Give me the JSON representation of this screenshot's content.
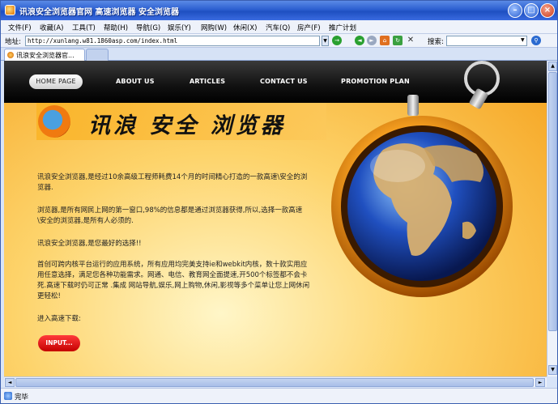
{
  "window": {
    "title": "讯浪安全浏览器官网 高速浏览器 安全浏览器"
  },
  "menu": [
    {
      "label": "文件(F)"
    },
    {
      "label": "收藏(A)"
    },
    {
      "label": "工具(T)"
    },
    {
      "label": "帮助(H)"
    },
    {
      "label": "导航(G)"
    },
    {
      "label": "娱乐(Y)"
    },
    {
      "label": "网购(W)"
    },
    {
      "label": "休闲(X)"
    },
    {
      "label": "汽车(Q)"
    },
    {
      "label": "房产(F)"
    },
    {
      "label": "推广计划"
    }
  ],
  "address": {
    "label": "地址:",
    "url": "http://xunlang.w81.1860asp.com/index.html"
  },
  "search": {
    "label": "搜索:"
  },
  "tab": {
    "label": "讯浪安全浏览器官..."
  },
  "page": {
    "nav": [
      {
        "label": "HOME PAGE"
      },
      {
        "label": "ABOUT US"
      },
      {
        "label": "ARTICLES"
      },
      {
        "label": "CONTACT US"
      },
      {
        "label": "PROMOTION PLAN"
      }
    ],
    "logo_text": "讯浪 安全 浏览器",
    "paragraphs": [
      "讯浪安全浏览器,是经过10余高级工程师耗费14个月的时间精心打造的一款高速\\安全的浏览器.",
      "浏览器,是所有网民上网的第一窗口,98%的信息都是通过浏览器获得,所以,选择一款高速\\安全的浏览器,是所有人必须的.",
      "讯浪安全浏览器,是您最好的选择!!",
      "首创可跨内核平台运行的应用系统，所有应用均完美支持ie和webkit内核，数十款实用应用任意选择，满足您各种功能需求。网通、电信、教育网全面提速,开500个标签都不会卡死.高速下载时仍可正常 .集成 网站导航,娱乐,网上购物,休闲,影视等多个菜单让您上网休闲更轻松!",
      "进入高速下载:"
    ],
    "input_button": "INPUT..."
  },
  "status": {
    "text": "完毕"
  }
}
